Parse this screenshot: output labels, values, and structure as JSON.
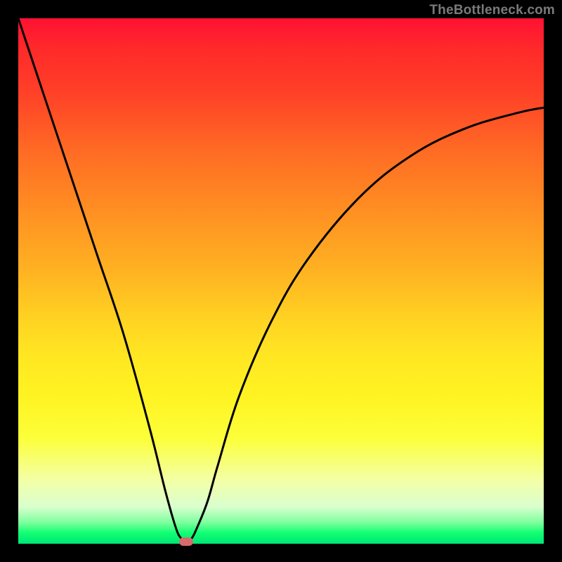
{
  "watermark": "TheBottleneck.com",
  "chart_data": {
    "type": "line",
    "title": "",
    "xlabel": "",
    "ylabel": "",
    "xlim": [
      0,
      100
    ],
    "ylim": [
      0,
      100
    ],
    "grid": false,
    "legend": false,
    "series": [
      {
        "name": "bottleneck-curve",
        "x": [
          0,
          5,
          10,
          15,
          20,
          25,
          28,
          30,
          31,
          32,
          33,
          34,
          36,
          38,
          42,
          48,
          55,
          65,
          75,
          85,
          95,
          100
        ],
        "y": [
          100,
          85,
          70,
          55,
          40,
          22,
          10,
          3,
          1,
          0,
          1,
          3,
          8,
          15,
          28,
          42,
          54,
          66,
          74,
          79,
          82,
          83
        ]
      }
    ],
    "marker": {
      "x": 32,
      "y": 0
    },
    "background_gradient": {
      "top": "#ff1133",
      "mid": "#ffd522",
      "bottom": "#00e676"
    }
  }
}
